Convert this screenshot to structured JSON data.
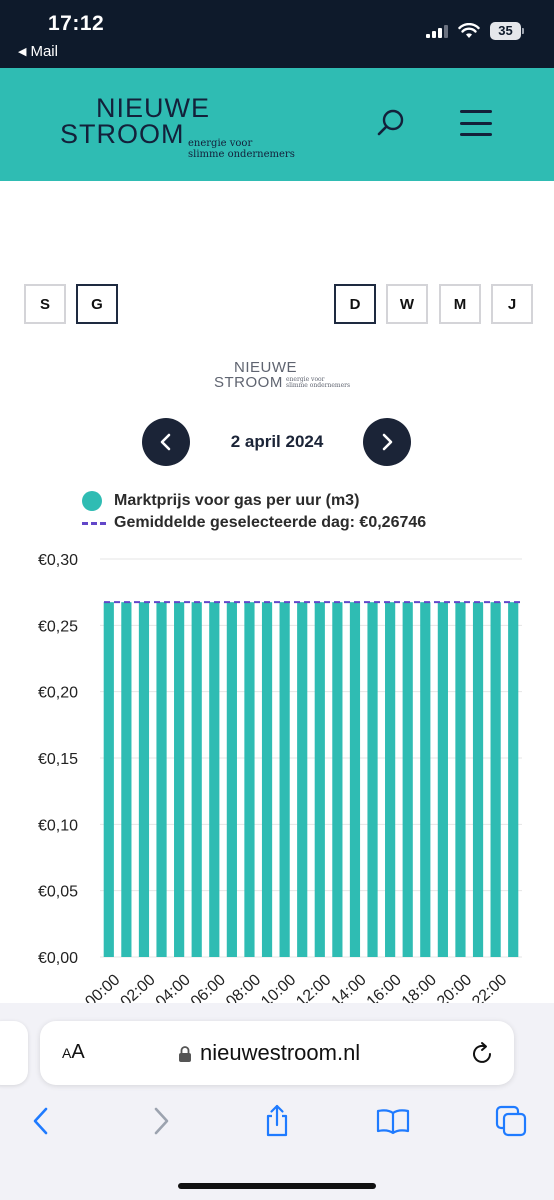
{
  "status_bar": {
    "time": "17:12",
    "back_label": "Mail",
    "battery": "35"
  },
  "header": {
    "logo_line1": "NIEUWE",
    "logo_line2": "STROOM",
    "logo_tag1": "energie voor",
    "logo_tag2": "slimme ondernemers",
    "accent_color": "#2fbcb3",
    "icons": [
      "search-icon",
      "hamburger-menu-icon"
    ]
  },
  "toggles": {
    "energy": [
      {
        "label": "S",
        "active": false
      },
      {
        "label": "G",
        "active": true
      }
    ],
    "period": [
      {
        "label": "D",
        "active": true
      },
      {
        "label": "W",
        "active": false
      },
      {
        "label": "M",
        "active": false
      },
      {
        "label": "J",
        "active": false
      }
    ]
  },
  "date_nav": {
    "date": "2 april 2024",
    "icons": [
      "chevron-left-icon",
      "chevron-right-icon"
    ]
  },
  "chart_data": {
    "type": "bar",
    "legend": [
      "Marktprijs voor gas per uur (m3)",
      "Gemiddelde geselecteerde dag: €0,26746"
    ],
    "categories": [
      "00:00",
      "01:00",
      "02:00",
      "03:00",
      "04:00",
      "05:00",
      "06:00",
      "07:00",
      "08:00",
      "09:00",
      "10:00",
      "11:00",
      "12:00",
      "13:00",
      "14:00",
      "15:00",
      "16:00",
      "17:00",
      "18:00",
      "19:00",
      "20:00",
      "21:00",
      "22:00",
      "23:00"
    ],
    "x_tick_labels": [
      "00:00",
      "02:00",
      "04:00",
      "06:00",
      "08:00",
      "10:00",
      "12:00",
      "14:00",
      "16:00",
      "18:00",
      "20:00",
      "22:00"
    ],
    "series": [
      {
        "name": "Marktprijs voor gas per uur (m3)",
        "values": [
          0.26746,
          0.26746,
          0.26746,
          0.26746,
          0.26746,
          0.26746,
          0.26746,
          0.26746,
          0.26746,
          0.26746,
          0.26746,
          0.26746,
          0.26746,
          0.26746,
          0.26746,
          0.26746,
          0.26746,
          0.26746,
          0.26746,
          0.26746,
          0.26746,
          0.26746,
          0.26746,
          0.26746
        ],
        "color": "#2fbcb3"
      }
    ],
    "average": {
      "value": 0.26746,
      "color": "#6247c9"
    },
    "y_ticks": [
      "€0,00",
      "€0,05",
      "€0,10",
      "€0,15",
      "€0,20",
      "€0,25",
      "€0,30"
    ],
    "ylim": [
      0,
      0.3
    ],
    "grid": true,
    "legend_position": "top-left"
  },
  "safari": {
    "aa_label": "AA",
    "url": "nieuwestroom.nl",
    "icons": [
      "lock-icon",
      "reload-icon",
      "back-icon",
      "forward-icon",
      "share-icon",
      "bookmarks-icon",
      "tabs-icon"
    ]
  }
}
